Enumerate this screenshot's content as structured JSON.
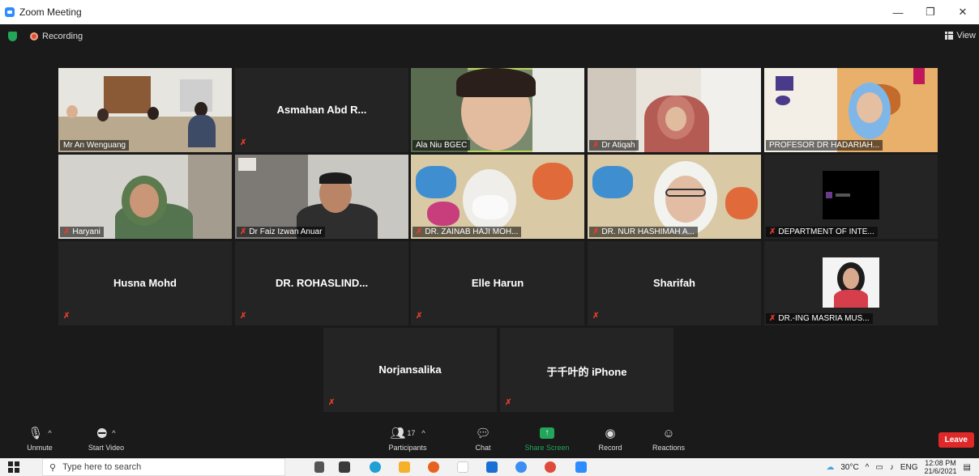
{
  "window": {
    "title": "Zoom Meeting",
    "minimize": "—",
    "restore": "❐",
    "close": "✕"
  },
  "topbar": {
    "recording_label": "Recording",
    "view_label": "View"
  },
  "participants": [
    {
      "name": "Mr An Wenguang",
      "video": true
    },
    {
      "name": "Asmahan Abd R...",
      "video": false
    },
    {
      "name": "Ala Niu BGEC",
      "video": true,
      "speaker": true
    },
    {
      "name": "Dr Atiqah",
      "video": true
    },
    {
      "name": "PROFESOR DR HADARIAH...",
      "video": true
    },
    {
      "name": "Haryani",
      "video": true
    },
    {
      "name": "Dr Faiz Izwan Anuar",
      "video": true
    },
    {
      "name": "DR. ZAINAB HAJI MOH...",
      "video": true
    },
    {
      "name": "DR. NUR HASHIMAH A...",
      "video": true
    },
    {
      "name": "DEPARTMENT OF INTE...",
      "video": true
    },
    {
      "name": "Husna Mohd",
      "video": false
    },
    {
      "name": "DR.  ROHASLIND...",
      "video": false
    },
    {
      "name": "Elle Harun",
      "video": false
    },
    {
      "name": "Sharifah",
      "video": false
    },
    {
      "name": "DR.-ING MASRIA MUS...",
      "video": true
    },
    {
      "name": "Norjansalika",
      "video": false
    },
    {
      "name": "于千叶的 iPhone",
      "video": false
    }
  ],
  "controls": {
    "unmute": "Unmute",
    "start_video": "Start Video",
    "participants": "Participants",
    "participants_count": "17",
    "chat": "Chat",
    "share_screen": "Share Screen",
    "record": "Record",
    "reactions": "Reactions",
    "leave": "Leave"
  },
  "taskbar": {
    "search_placeholder": "Type here to search",
    "temperature": "30°C",
    "language": "ENG",
    "time": "12:08 PM",
    "date": "21/6/2021"
  },
  "colors": {
    "accent_green": "#23a55a",
    "leave_red": "#e02828",
    "speaker_outline": "#b9d65b"
  }
}
